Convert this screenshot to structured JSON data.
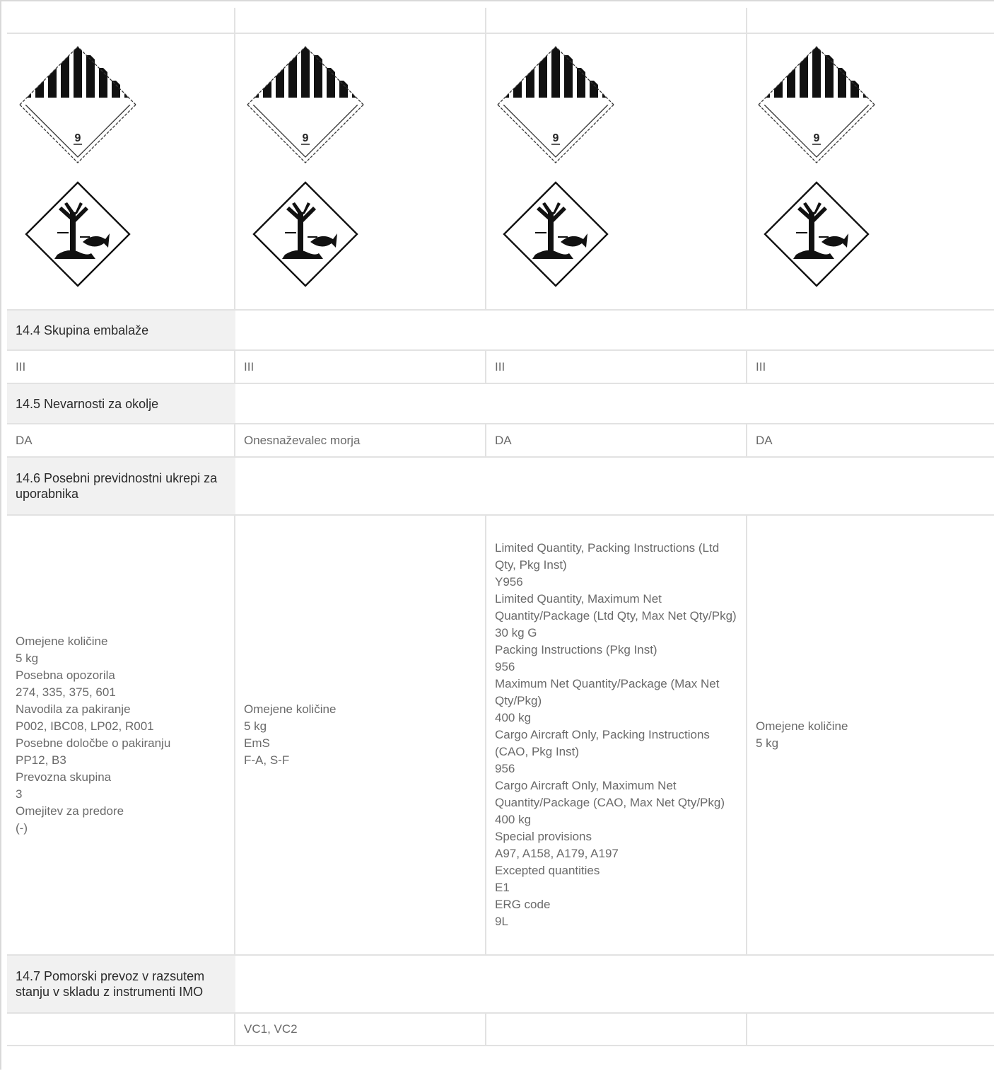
{
  "pictograms": {
    "class9_icon": "class-9-miscellaneous-hazard-diamond",
    "env_icon": "environmental-hazard-diamond",
    "class9_label": "9"
  },
  "section_14_4": {
    "heading": "14.4 Skupina embalaže",
    "values": [
      "III",
      "III",
      "III",
      "III"
    ]
  },
  "section_14_5": {
    "heading": "14.5 Nevarnosti za okolje",
    "values": [
      "DA",
      "Onesnaževalec morja",
      "DA",
      "DA"
    ]
  },
  "section_14_6": {
    "heading": "14.6 Posebni previdnostni ukrepi za uporabnika",
    "values": [
      "Omejene količine\n5 kg\nPosebna opozorila\n274, 335, 375, 601\nNavodila za pakiranje\nP002, IBC08, LP02, R001\nPosebne določbe o pakiranju\nPP12, B3\nPrevozna skupina\n3\nOmejitev za predore\n(-)",
      "Omejene količine\n5 kg\nEmS\nF-A, S-F",
      "Limited Quantity, Packing Instructions (Ltd Qty, Pkg Inst)\nY956\nLimited Quantity, Maximum Net Quantity/Package (Ltd Qty, Max Net Qty/Pkg)\n30 kg G\nPacking Instructions (Pkg Inst)\n956\nMaximum Net Quantity/Package (Max Net Qty/Pkg)\n400 kg\nCargo Aircraft Only, Packing Instructions (CAO, Pkg Inst)\n956\nCargo Aircraft Only, Maximum Net Quantity/Package (CAO, Max Net Qty/Pkg)\n400 kg\nSpecial provisions\nA97, A158, A179, A197\nExcepted quantities\nE1\nERG code\n9L",
      "Omejene količine\n5 kg"
    ]
  },
  "section_14_7": {
    "heading": "14.7 Pomorski prevoz v razsutem stanju v skladu z instrumenti IMO",
    "values": [
      "",
      "VC1, VC2",
      "",
      ""
    ]
  }
}
